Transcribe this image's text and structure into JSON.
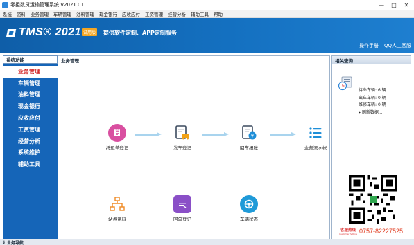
{
  "window": {
    "title": "零担数货运输管理系统 V2021.01",
    "controls": [
      "—",
      "□",
      "✕"
    ]
  },
  "menu": [
    "系统",
    "资料",
    "业务管理",
    "车辆管理",
    "油料管理",
    "现金银行",
    "应收应付",
    "工资管理",
    "经营分析",
    "辅助工具",
    "帮助"
  ],
  "banner": {
    "logo": "TMS® 2021",
    "trial_badge": "试用版",
    "slogan": "提供软件定制、APP定制服务",
    "links": [
      "操作手册",
      "QQ人工客服"
    ]
  },
  "sidebar": {
    "title": "系统功能",
    "items": [
      "业务管理",
      "车辆管理",
      "油料管理",
      "现金银行",
      "应收应付",
      "工资管理",
      "经营分析",
      "系统维护",
      "辅助工具"
    ],
    "active": "业务管理"
  },
  "main": {
    "title": "业务管理",
    "flow_row1": [
      {
        "label": "托运单登记",
        "icon": "clipboard-icon",
        "color": "#d94fa0"
      },
      {
        "label": "发车登记",
        "icon": "truck-document-icon",
        "color": "#f2a216"
      },
      {
        "label": "回车报账",
        "icon": "yen-document-icon",
        "color": "#1f8fd8"
      },
      {
        "label": "业务流水帐",
        "icon": "list-icon",
        "color": "#1f8fd8"
      }
    ],
    "flow_row2": [
      {
        "label": "站点资料",
        "icon": "org-chart-icon",
        "color": "#f08a24"
      },
      {
        "label": "回单登记",
        "icon": "receipt-icon",
        "color": "#8a4fc7"
      },
      {
        "label": "车辆状态",
        "icon": "steering-icon",
        "color": "#1f9ad8"
      }
    ]
  },
  "right_panel": {
    "title": "相关查询",
    "stats": [
      {
        "label": "待命车辆:",
        "value": "6 辆"
      },
      {
        "label": "出车车辆:",
        "value": "0 辆"
      },
      {
        "label": "维修车辆:",
        "value": "0 辆"
      }
    ],
    "refresh": "刷新数据...",
    "hotline_label": "客服热线",
    "hotline_sub": "Customer hotline",
    "phone": "0757-82227525"
  },
  "statusbar": {
    "label": "业务导航"
  }
}
